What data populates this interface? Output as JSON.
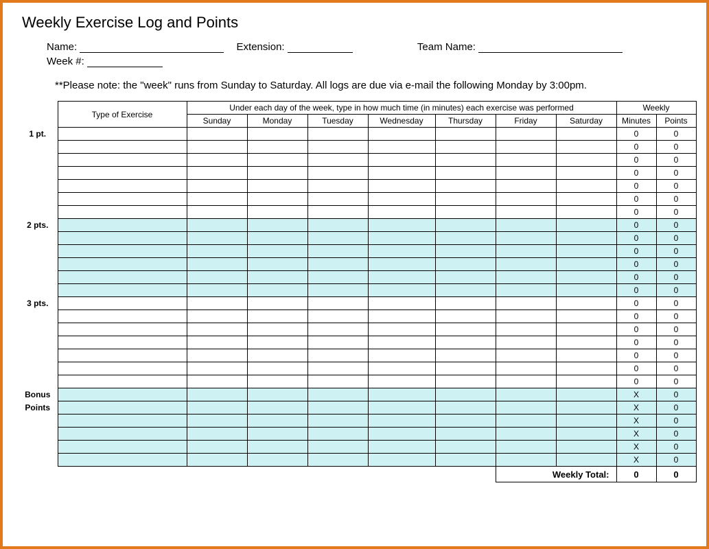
{
  "title": "Weekly Exercise Log and Points",
  "fields": {
    "name_label": "Name:",
    "extension_label": "Extension:",
    "team_label": "Team Name:",
    "week_label": "Week #:"
  },
  "note": "**Please note: the \"week\" runs from Sunday to Saturday.  All logs are due via e-mail the following Monday by 3:00pm.",
  "headers": {
    "type": "Type of Exercise",
    "instruction": "Under each day of the week, type in how much time (in minutes) each exercise was performed",
    "weekly": "Weekly",
    "days": [
      "Sunday",
      "Monday",
      "Tuesday",
      "Wednesday",
      "Thursday",
      "Friday",
      "Saturday"
    ],
    "minutes": "Minutes",
    "points": "Points"
  },
  "sections": [
    {
      "label": "1 pt.",
      "tint": false,
      "rows": 7
    },
    {
      "label": "2 pts.",
      "tint": true,
      "rows": 6
    },
    {
      "label": "3 pts.",
      "tint": false,
      "rows": 7
    },
    {
      "label": "Bonus Points",
      "tint": true,
      "rows": 6,
      "minutes_value": "X"
    }
  ],
  "defaults": {
    "minutes": "0",
    "points": "0"
  },
  "totals": {
    "label": "Weekly Total:",
    "minutes": "0",
    "points": "0"
  }
}
